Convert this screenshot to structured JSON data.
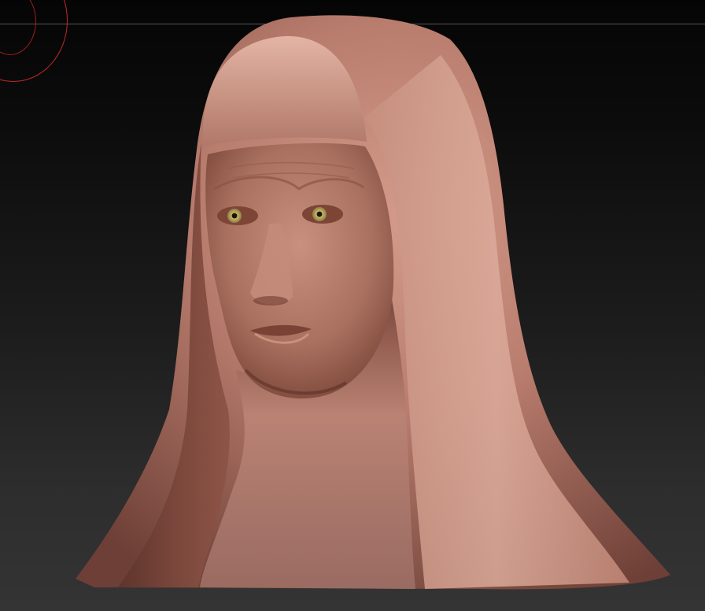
{
  "viewport": {
    "background_top": "#050505",
    "background_bottom": "#343434",
    "horizon_line_color": "#6a6a6a",
    "brush_cursor_color": "#c42828"
  },
  "model": {
    "material_color": "#b77a6c",
    "eye_iris_color": "#c9b765",
    "icon": "sculpted-bust"
  }
}
